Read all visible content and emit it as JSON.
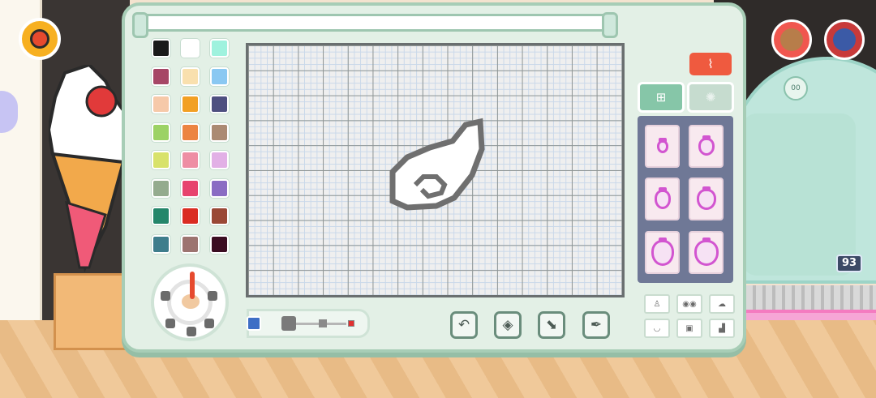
{
  "palette": {
    "colors": [
      "#1a1a1a",
      "#ffffff",
      "#9ff2de",
      "#a64666",
      "#f9e0ae",
      "#8ac8f2",
      "#f6c9a9",
      "#f2a024",
      "#4e4f80",
      "#9cd265",
      "#ec8442",
      "#ab8a73",
      "#d8e26b",
      "#ee8ea4",
      "#e2b0e6",
      "#94ab8e",
      "#e7436e",
      "#8a6cc3",
      "#24866a",
      "#da2c22",
      "#9a4836",
      "#3e7d8c",
      "#9c7470",
      "#3b0d22"
    ]
  },
  "toolbar": {
    "clear_icon": "broom-icon",
    "tools": [
      {
        "name": "undo",
        "icon": "undo-icon",
        "glyph": "↶"
      },
      {
        "name": "eraser",
        "icon": "eraser-icon",
        "glyph": "◈"
      },
      {
        "name": "fill",
        "icon": "fill-bucket-icon",
        "glyph": "⬊"
      },
      {
        "name": "eyedropper",
        "icon": "eyedropper-icon",
        "glyph": "✒"
      }
    ]
  },
  "side": {
    "tabs": [
      {
        "name": "stamps",
        "icon": "stamp-icon",
        "glyph": "⊞",
        "active": true
      },
      {
        "name": "effects",
        "icon": "swirl-icon",
        "glyph": "✺",
        "active": false
      }
    ]
  },
  "hud": {
    "counter": "93",
    "timer_label": "00"
  },
  "colors": {
    "panel": "#e3f0e6",
    "accent": "#86c6a8",
    "clear": "#ef5a3f"
  }
}
